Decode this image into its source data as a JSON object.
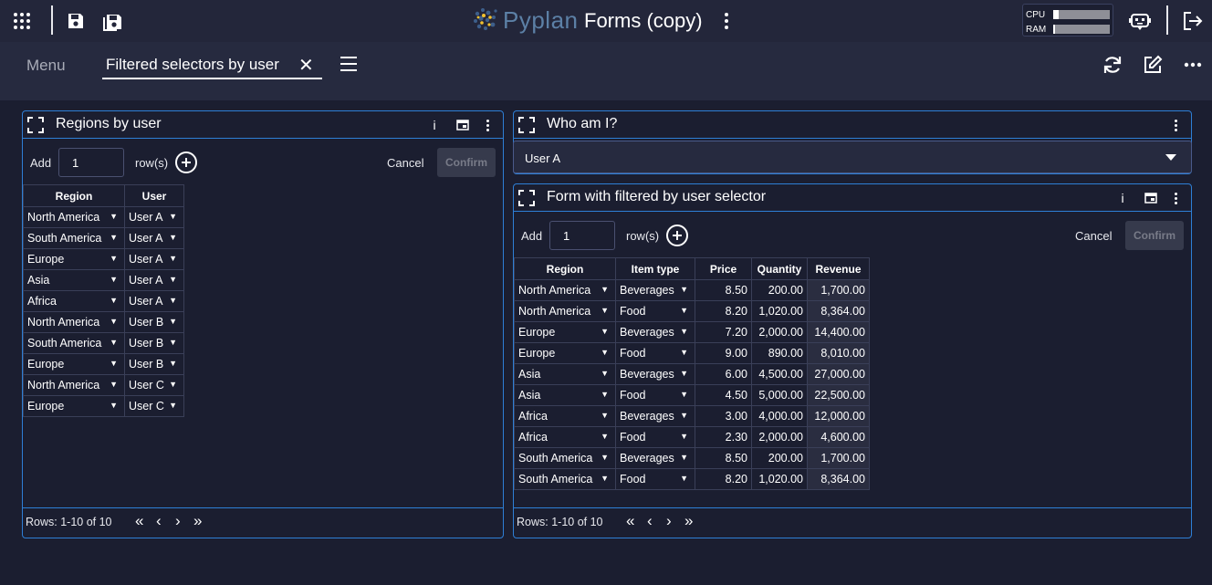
{
  "topbar": {
    "logo_text": "Pyplan",
    "app_title": "Forms (copy)",
    "cpu_label": "CPU",
    "ram_label": "RAM",
    "cpu_usage": 0.1,
    "ram_usage": 0.04
  },
  "tabs": {
    "menu_label": "Menu",
    "active_label": "Filtered selectors by user",
    "close_glyph": "✕"
  },
  "regions_panel": {
    "title": "Regions by user",
    "add_label": "Add",
    "add_value": "1",
    "rows_label": "row(s)",
    "cancel_label": "Cancel",
    "confirm_label": "Confirm",
    "columns": [
      "Region",
      "User"
    ],
    "rows": [
      [
        "North America",
        "User A"
      ],
      [
        "South America",
        "User A"
      ],
      [
        "Europe",
        "User A"
      ],
      [
        "Asia",
        "User A"
      ],
      [
        "Africa",
        "User A"
      ],
      [
        "North America",
        "User B"
      ],
      [
        "South America",
        "User B"
      ],
      [
        "Europe",
        "User B"
      ],
      [
        "North America",
        "User C"
      ],
      [
        "Europe",
        "User C"
      ]
    ],
    "footer": "Rows: 1-10 of 10"
  },
  "who_panel": {
    "title": "Who am I?",
    "selected_value": "User A"
  },
  "form_panel": {
    "title": "Form with filtered by user selector",
    "add_label": "Add",
    "add_value": "1",
    "rows_label": "row(s)",
    "cancel_label": "Cancel",
    "confirm_label": "Confirm",
    "columns": [
      "Region",
      "Item type",
      "Price",
      "Quantity",
      "Revenue"
    ],
    "rows": [
      [
        "North America",
        "Beverages",
        "8.50",
        "200.00",
        "1,700.00"
      ],
      [
        "North America",
        "Food",
        "8.20",
        "1,020.00",
        "8,364.00"
      ],
      [
        "Europe",
        "Beverages",
        "7.20",
        "2,000.00",
        "14,400.00"
      ],
      [
        "Europe",
        "Food",
        "9.00",
        "890.00",
        "8,010.00"
      ],
      [
        "Asia",
        "Beverages",
        "6.00",
        "4,500.00",
        "27,000.00"
      ],
      [
        "Asia",
        "Food",
        "4.50",
        "5,000.00",
        "22,500.00"
      ],
      [
        "Africa",
        "Beverages",
        "3.00",
        "4,000.00",
        "12,000.00"
      ],
      [
        "Africa",
        "Food",
        "2.30",
        "2,000.00",
        "4,600.00"
      ],
      [
        "South America",
        "Beverages",
        "8.50",
        "200.00",
        "1,700.00"
      ],
      [
        "South America",
        "Food",
        "8.20",
        "1,020.00",
        "8,364.00"
      ]
    ],
    "footer": "Rows: 1-10 of 10"
  },
  "glyphs": {
    "dropdown_arrow": "▼",
    "info": "i",
    "first_page": "«",
    "prev_page": "‹",
    "next_page": "›",
    "last_page": "»"
  }
}
